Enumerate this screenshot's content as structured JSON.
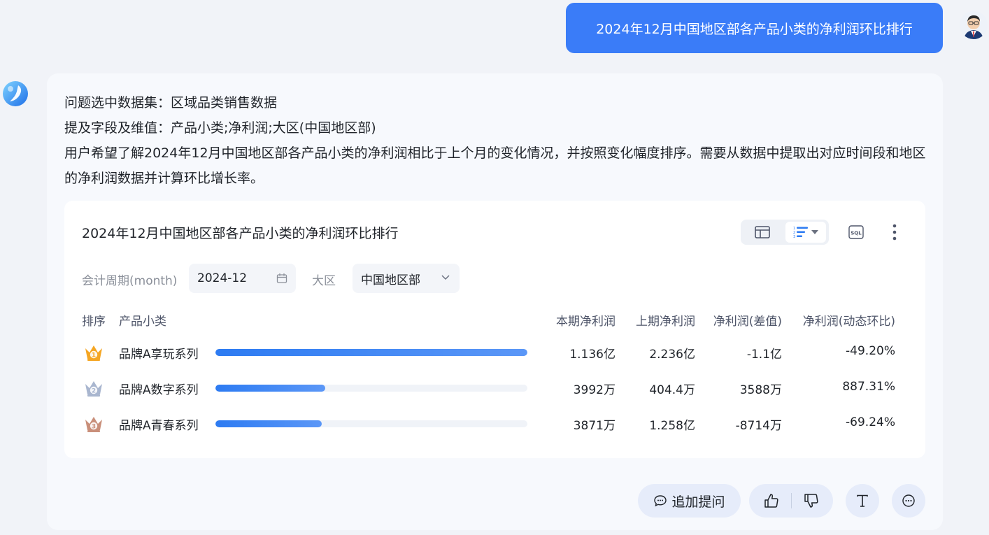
{
  "user_message": "2024年12月中国地区部各产品小类的净利润环比排行",
  "analysis": {
    "line1": "问题选中数据集：区域品类销售数据",
    "line2": "提及字段及维值：产品小类;净利润;大区(中国地区部)",
    "line3": "用户希望了解2024年12月中国地区部各产品小类的净利润相比于上个月的变化情况，并按照变化幅度排序。需要从数据中提取出对应时间段和地区的净利润数据并计算环比增长率。"
  },
  "card": {
    "title": "2024年12月中国地区部各产品小类的净利润环比排行",
    "sql_label": "SQL",
    "filters": {
      "period_label": "会计周期(month)",
      "period_value": "2024-12",
      "region_label": "大区",
      "region_value": "中国地区部"
    },
    "headers": {
      "rank": "排序",
      "product": "产品小类",
      "current": "本期净利润",
      "previous": "上期净利润",
      "diff": "净利润(差值)",
      "mom": "净利润(动态环比)"
    },
    "rows": [
      {
        "rank": "1",
        "name": "品牌A享玩系列",
        "bar": 1.0,
        "current": "1.136亿",
        "previous": "2.236亿",
        "diff": "-1.1亿",
        "mom": "-49.20%",
        "medal_color": "#f5a623"
      },
      {
        "rank": "2",
        "name": "品牌A数字系列",
        "bar": 0.352,
        "current": "3992万",
        "previous": "404.4万",
        "diff": "3588万",
        "mom": "887.31%",
        "medal_color": "#a9b6cf"
      },
      {
        "rank": "3",
        "name": "品牌A青春系列",
        "bar": 0.341,
        "current": "3871万",
        "previous": "1.258亿",
        "diff": "-8714万",
        "mom": "-69.24%",
        "medal_color": "#c98f7a"
      }
    ]
  },
  "actions": {
    "follow_up": "追加提问"
  }
}
